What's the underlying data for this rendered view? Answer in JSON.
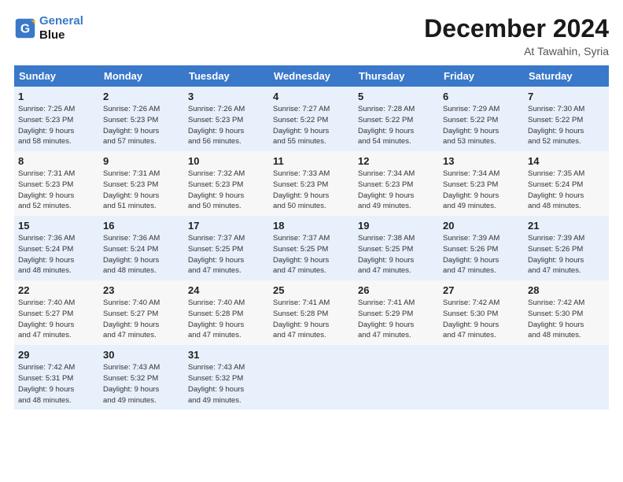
{
  "logo": {
    "line1": "General",
    "line2": "Blue"
  },
  "title": "December 2024",
  "location": "At Tawahin, Syria",
  "days_of_week": [
    "Sunday",
    "Monday",
    "Tuesday",
    "Wednesday",
    "Thursday",
    "Friday",
    "Saturday"
  ],
  "weeks": [
    [
      {
        "day": 1,
        "info": "Sunrise: 7:25 AM\nSunset: 5:23 PM\nDaylight: 9 hours\nand 58 minutes."
      },
      {
        "day": 2,
        "info": "Sunrise: 7:26 AM\nSunset: 5:23 PM\nDaylight: 9 hours\nand 57 minutes."
      },
      {
        "day": 3,
        "info": "Sunrise: 7:26 AM\nSunset: 5:23 PM\nDaylight: 9 hours\nand 56 minutes."
      },
      {
        "day": 4,
        "info": "Sunrise: 7:27 AM\nSunset: 5:22 PM\nDaylight: 9 hours\nand 55 minutes."
      },
      {
        "day": 5,
        "info": "Sunrise: 7:28 AM\nSunset: 5:22 PM\nDaylight: 9 hours\nand 54 minutes."
      },
      {
        "day": 6,
        "info": "Sunrise: 7:29 AM\nSunset: 5:22 PM\nDaylight: 9 hours\nand 53 minutes."
      },
      {
        "day": 7,
        "info": "Sunrise: 7:30 AM\nSunset: 5:22 PM\nDaylight: 9 hours\nand 52 minutes."
      }
    ],
    [
      {
        "day": 8,
        "info": "Sunrise: 7:31 AM\nSunset: 5:23 PM\nDaylight: 9 hours\nand 52 minutes."
      },
      {
        "day": 9,
        "info": "Sunrise: 7:31 AM\nSunset: 5:23 PM\nDaylight: 9 hours\nand 51 minutes."
      },
      {
        "day": 10,
        "info": "Sunrise: 7:32 AM\nSunset: 5:23 PM\nDaylight: 9 hours\nand 50 minutes."
      },
      {
        "day": 11,
        "info": "Sunrise: 7:33 AM\nSunset: 5:23 PM\nDaylight: 9 hours\nand 50 minutes."
      },
      {
        "day": 12,
        "info": "Sunrise: 7:34 AM\nSunset: 5:23 PM\nDaylight: 9 hours\nand 49 minutes."
      },
      {
        "day": 13,
        "info": "Sunrise: 7:34 AM\nSunset: 5:23 PM\nDaylight: 9 hours\nand 49 minutes."
      },
      {
        "day": 14,
        "info": "Sunrise: 7:35 AM\nSunset: 5:24 PM\nDaylight: 9 hours\nand 48 minutes."
      }
    ],
    [
      {
        "day": 15,
        "info": "Sunrise: 7:36 AM\nSunset: 5:24 PM\nDaylight: 9 hours\nand 48 minutes."
      },
      {
        "day": 16,
        "info": "Sunrise: 7:36 AM\nSunset: 5:24 PM\nDaylight: 9 hours\nand 48 minutes."
      },
      {
        "day": 17,
        "info": "Sunrise: 7:37 AM\nSunset: 5:25 PM\nDaylight: 9 hours\nand 47 minutes."
      },
      {
        "day": 18,
        "info": "Sunrise: 7:37 AM\nSunset: 5:25 PM\nDaylight: 9 hours\nand 47 minutes."
      },
      {
        "day": 19,
        "info": "Sunrise: 7:38 AM\nSunset: 5:25 PM\nDaylight: 9 hours\nand 47 minutes."
      },
      {
        "day": 20,
        "info": "Sunrise: 7:39 AM\nSunset: 5:26 PM\nDaylight: 9 hours\nand 47 minutes."
      },
      {
        "day": 21,
        "info": "Sunrise: 7:39 AM\nSunset: 5:26 PM\nDaylight: 9 hours\nand 47 minutes."
      }
    ],
    [
      {
        "day": 22,
        "info": "Sunrise: 7:40 AM\nSunset: 5:27 PM\nDaylight: 9 hours\nand 47 minutes."
      },
      {
        "day": 23,
        "info": "Sunrise: 7:40 AM\nSunset: 5:27 PM\nDaylight: 9 hours\nand 47 minutes."
      },
      {
        "day": 24,
        "info": "Sunrise: 7:40 AM\nSunset: 5:28 PM\nDaylight: 9 hours\nand 47 minutes."
      },
      {
        "day": 25,
        "info": "Sunrise: 7:41 AM\nSunset: 5:28 PM\nDaylight: 9 hours\nand 47 minutes."
      },
      {
        "day": 26,
        "info": "Sunrise: 7:41 AM\nSunset: 5:29 PM\nDaylight: 9 hours\nand 47 minutes."
      },
      {
        "day": 27,
        "info": "Sunrise: 7:42 AM\nSunset: 5:30 PM\nDaylight: 9 hours\nand 47 minutes."
      },
      {
        "day": 28,
        "info": "Sunrise: 7:42 AM\nSunset: 5:30 PM\nDaylight: 9 hours\nand 48 minutes."
      }
    ],
    [
      {
        "day": 29,
        "info": "Sunrise: 7:42 AM\nSunset: 5:31 PM\nDaylight: 9 hours\nand 48 minutes."
      },
      {
        "day": 30,
        "info": "Sunrise: 7:43 AM\nSunset: 5:32 PM\nDaylight: 9 hours\nand 49 minutes."
      },
      {
        "day": 31,
        "info": "Sunrise: 7:43 AM\nSunset: 5:32 PM\nDaylight: 9 hours\nand 49 minutes."
      },
      null,
      null,
      null,
      null
    ]
  ]
}
